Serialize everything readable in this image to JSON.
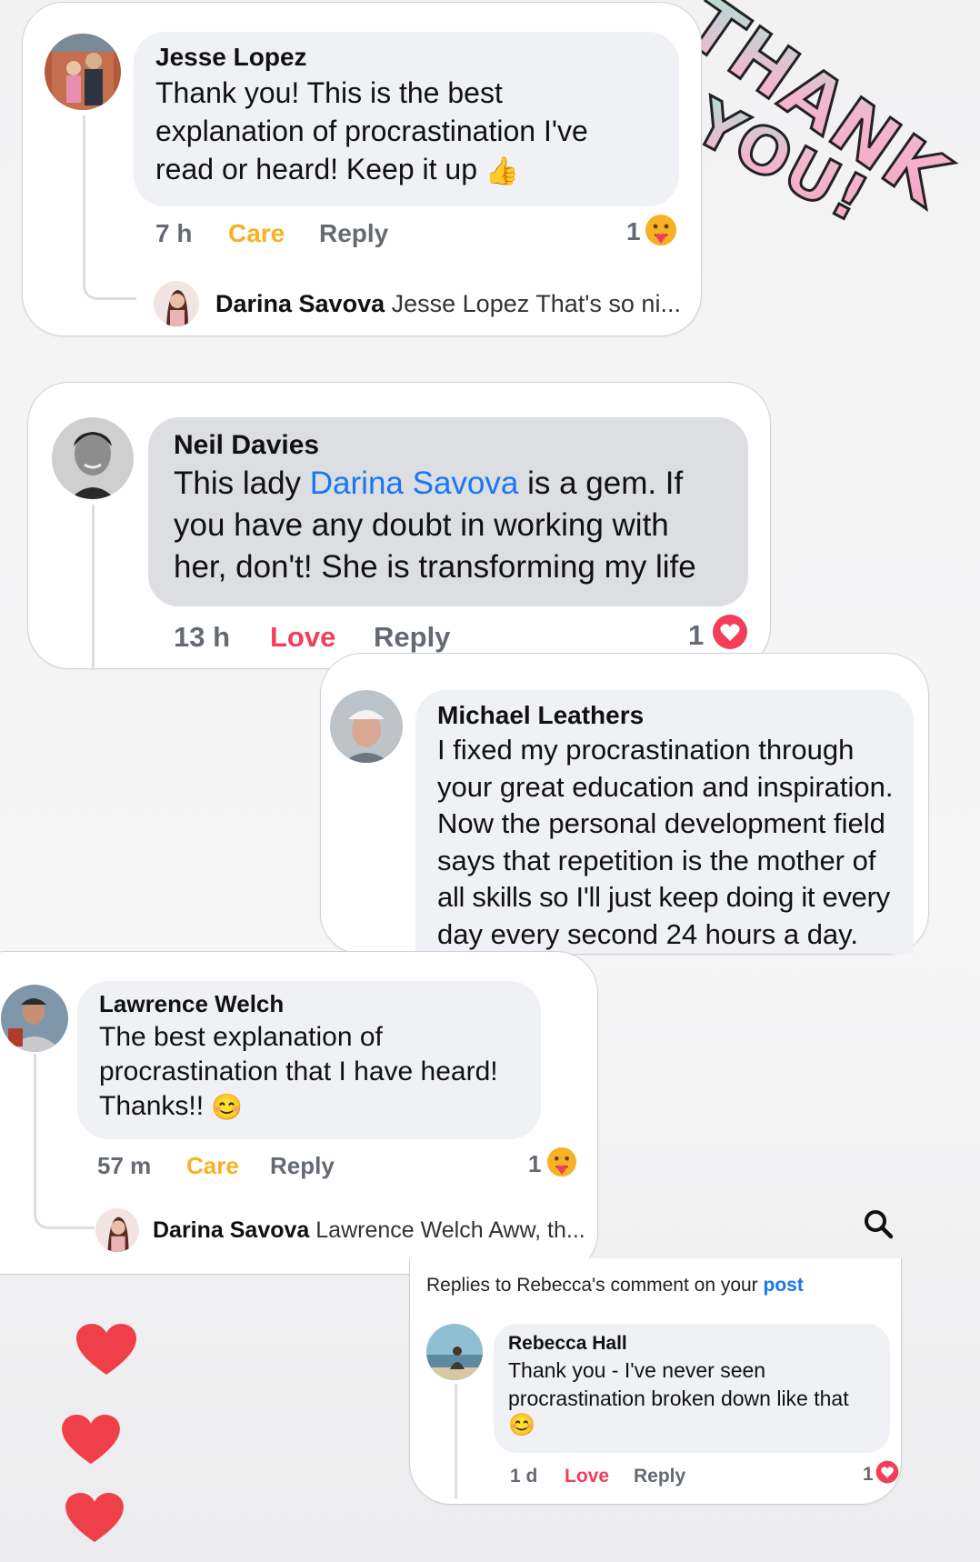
{
  "thank_you_sticker": {
    "line1": "THANK",
    "line2": "YOU!"
  },
  "comments": [
    {
      "author": "Jesse Lopez",
      "text_lines": [
        "Thank you!  This is the best",
        "explanation of procrastination I've",
        "read or heard! Keep it up"
      ],
      "time": "7 h",
      "reaction_label": "Care",
      "reply_label": "Reply",
      "reaction_count": "1",
      "reply_preview": {
        "author": "Darina Savova",
        "text": "Jesse Lopez That's so ni..."
      }
    },
    {
      "author": "Neil Davies",
      "text_parts": {
        "before": "This lady ",
        "mention": "Darina Savova",
        "after": " is a gem. If"
      },
      "text_lines": [
        "you have any doubt in working with",
        "her, don't! She is transforming my life"
      ],
      "time": "13 h",
      "reaction_label": "Love",
      "reply_label": "Reply",
      "reaction_count": "1"
    },
    {
      "author": "Michael Leathers",
      "text_lines": [
        "I fixed my procrastination through",
        "your great education and inspiration.",
        "Now the personal development field",
        "says that repetition is the mother of",
        "all skills so I'll just keep doing it every",
        "day every second 24 hours a day."
      ]
    },
    {
      "author": "Lawrence Welch",
      "text_lines": [
        "The best explanation of",
        "procrastination that I have heard!",
        "Thanks!!"
      ],
      "time": "57 m",
      "reaction_label": "Care",
      "reply_label": "Reply",
      "reaction_count": "1",
      "reply_preview": {
        "author": "Darina Savova",
        "text": "Lawrence Welch Aww, th..."
      }
    },
    {
      "header_prefix": "Replies to Rebecca's comment on your ",
      "header_link": "post",
      "author": "Rebecca Hall",
      "text_lines": [
        "Thank you - I've never seen",
        "procrastination broken down like that"
      ],
      "time": "1 d",
      "reaction_label": "Love",
      "reply_label": "Reply",
      "reaction_count": "1"
    }
  ],
  "icons": [
    "thumbs-up-emoji",
    "care-reaction-icon",
    "love-reaction-icon",
    "smile-emoji",
    "search-icon",
    "heart-sticker"
  ],
  "colors": {
    "love": "#f33e58",
    "care": "#f7b125",
    "link": "#1877f2",
    "meta": "#656a72",
    "bubble": "#eff1f4"
  }
}
